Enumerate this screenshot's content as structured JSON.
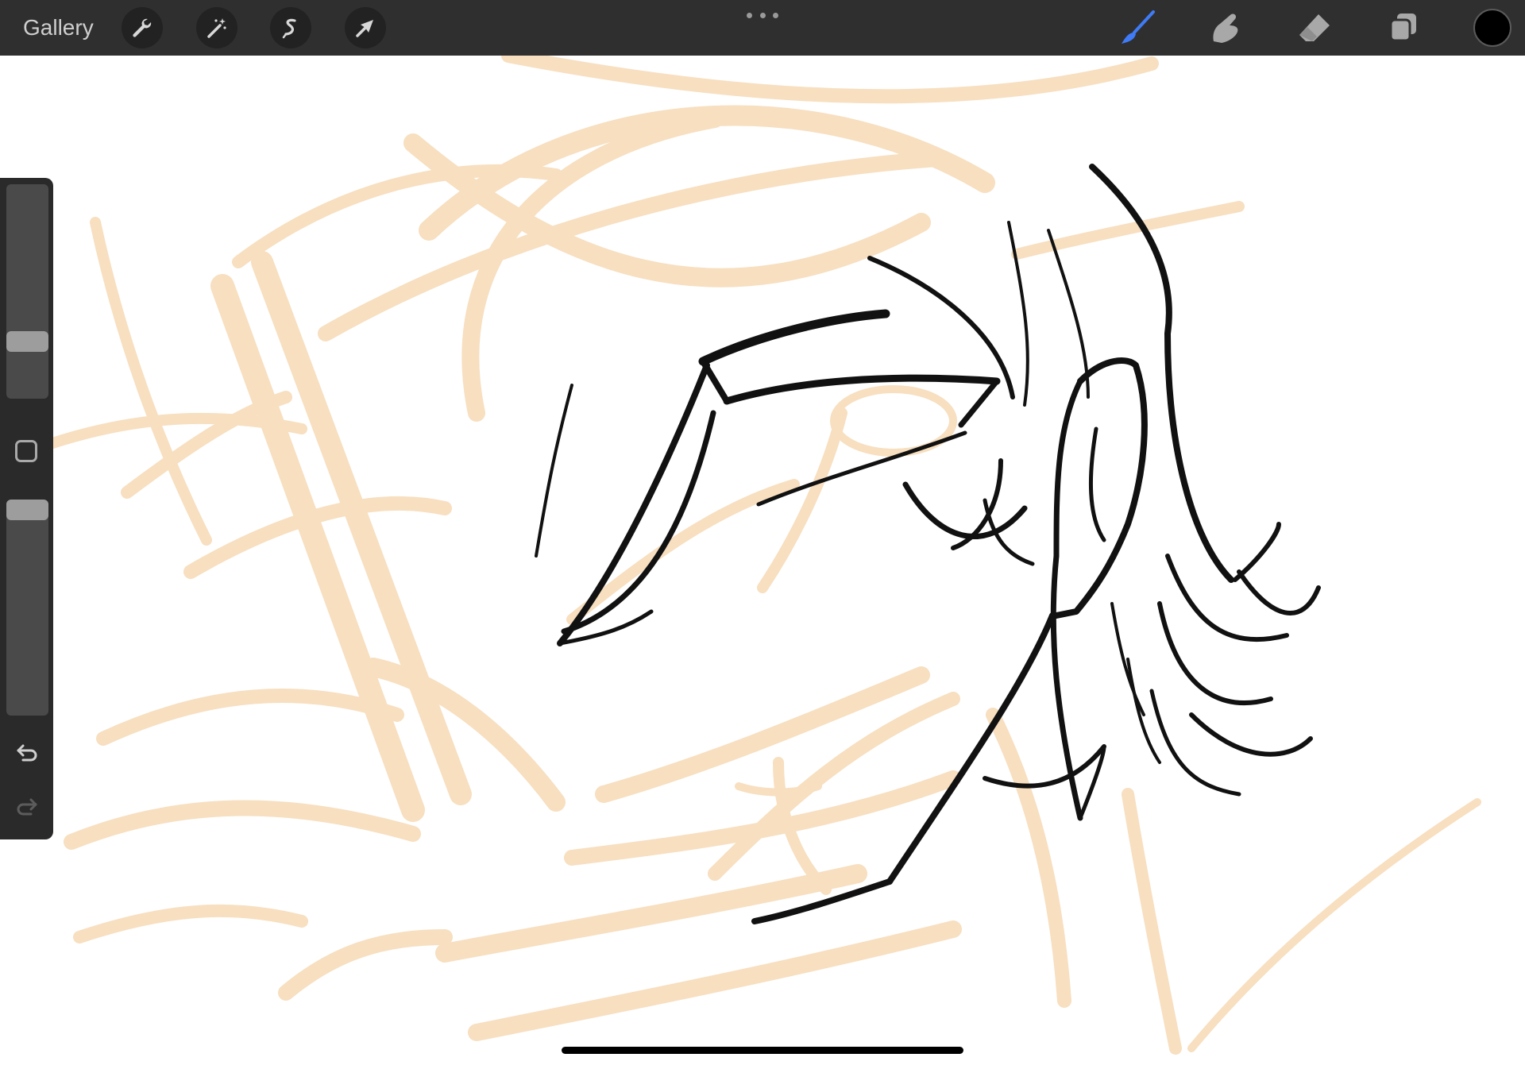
{
  "app": {
    "gallery_label": "Gallery"
  },
  "toolbar_left": {
    "tools": [
      {
        "name": "actions",
        "icon": "wrench-icon"
      },
      {
        "name": "adjustments",
        "icon": "magic-wand-icon"
      },
      {
        "name": "selection",
        "icon": "selection-s-icon"
      },
      {
        "name": "transform",
        "icon": "arrow-cursor-icon"
      }
    ]
  },
  "toolbar_center": {
    "icon": "more-options-icon"
  },
  "toolbar_right": {
    "tools": [
      {
        "name": "brush",
        "icon": "brush-icon",
        "active": true,
        "color": "#3f7bf6"
      },
      {
        "name": "smudge",
        "icon": "smudge-finger-icon",
        "active": false,
        "color": "#a8a8a8"
      },
      {
        "name": "eraser",
        "icon": "eraser-icon",
        "active": false,
        "color": "#a8a8a8"
      },
      {
        "name": "layers",
        "icon": "layers-icon",
        "active": false,
        "color": "#a8a8a8"
      }
    ],
    "current_color": "#000000"
  },
  "sidebar": {
    "brush_size_level": 0.24,
    "opacity_level": 1.0,
    "modify_icon": "square-modify-icon",
    "undo_icon": "undo-icon",
    "redo_icon": "redo-icon"
  },
  "colors": {
    "toolbar_bg": "#2f2f2f",
    "sidebar_bg": "#2a2a2a",
    "canvas_bg": "#ffffff",
    "sketch_layer": "#f7dfc0",
    "ink_layer": "#111111",
    "accent": "#3f7bf6"
  }
}
